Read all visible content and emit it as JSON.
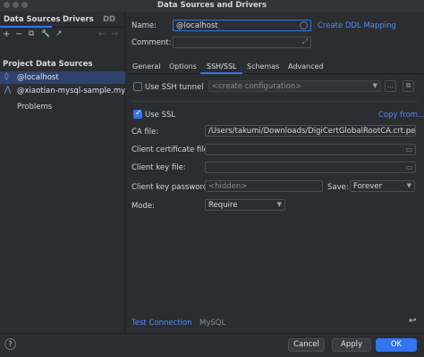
{
  "window": {
    "title": "Data Sources and Drivers"
  },
  "left": {
    "tabs": [
      "Data Sources",
      "Drivers",
      "DD"
    ],
    "toolbar": {
      "add": "+",
      "remove": "−",
      "copy": "⧉",
      "settings": "🔧",
      "export": "↗",
      "back": "←",
      "forward": "→"
    },
    "section_title": "Project Data Sources",
    "items": [
      {
        "label": "@localhost",
        "icon": "mysql-icon"
      },
      {
        "label": "@xiaotian-mysql-sample.mysql.d",
        "icon": "mysql-icon"
      }
    ],
    "problems": "Problems"
  },
  "right": {
    "name_label": "Name:",
    "name_value": "@localhost",
    "ddl_link": "Create DDL Mapping",
    "comment_label": "Comment:",
    "comment_value": "",
    "subtabs": [
      "General",
      "Options",
      "SSH/SSL",
      "Schemas",
      "Advanced"
    ],
    "ssh_tunnel_label": "Use SSH tunnel",
    "ssh_config_placeholder": "<create configuration>",
    "ssh_more": "...",
    "use_ssl_label": "Use SSL",
    "copy_from": "Copy from...",
    "ca_file_label": "CA file:",
    "ca_file_value": "/Users/takumi/Downloads/DigiCertGlobalRootCA.crt.pem",
    "client_cert_label": "Client certificate file:",
    "client_cert_value": "",
    "client_key_label": "Client key file:",
    "client_key_value": "",
    "client_key_password_label": "Client key password:",
    "client_key_password_value": "<hidden>",
    "save_label": "Save:",
    "save_value": "Forever",
    "mode_label": "Mode:",
    "mode_value": "Require",
    "test_connection": "Test Connection",
    "driver_label": "MySQL",
    "reset": "↩"
  },
  "footer": {
    "help": "?",
    "cancel": "Cancel",
    "apply": "Apply",
    "ok": "OK"
  }
}
